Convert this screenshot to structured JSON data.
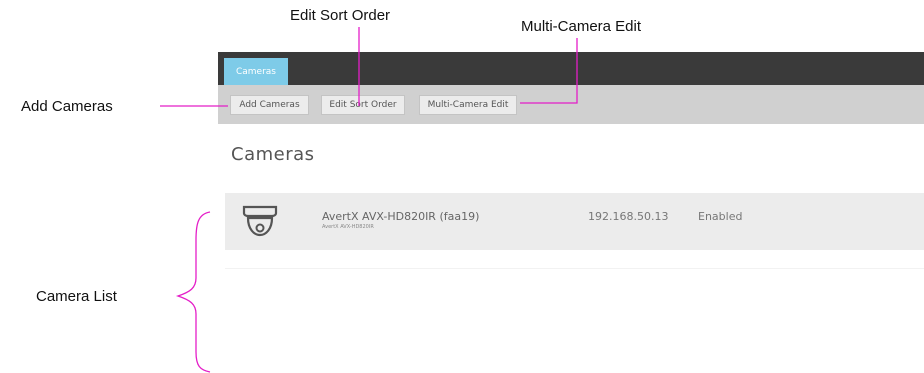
{
  "callouts": {
    "edit_sort_order": "Edit Sort Order",
    "multi_camera_edit": "Multi-Camera Edit",
    "add_cameras": "Add Cameras",
    "camera_list": "Camera List"
  },
  "callout_color": "#e41ec8",
  "app": {
    "tabs": [
      {
        "label": "Cameras",
        "active": true
      }
    ],
    "toolbar": {
      "add_cameras": "Add Cameras",
      "edit_sort_order": "Edit Sort Order",
      "multi_camera_edit": "Multi-Camera Edit"
    },
    "page_title": "Cameras",
    "cameras": [
      {
        "name": "AvertX AVX-HD820IR (faa19)",
        "model": "AvertX AVX-HD820IR",
        "ip": "192.168.50.13",
        "status": "Enabled",
        "icon": "dome-camera-icon"
      }
    ]
  }
}
